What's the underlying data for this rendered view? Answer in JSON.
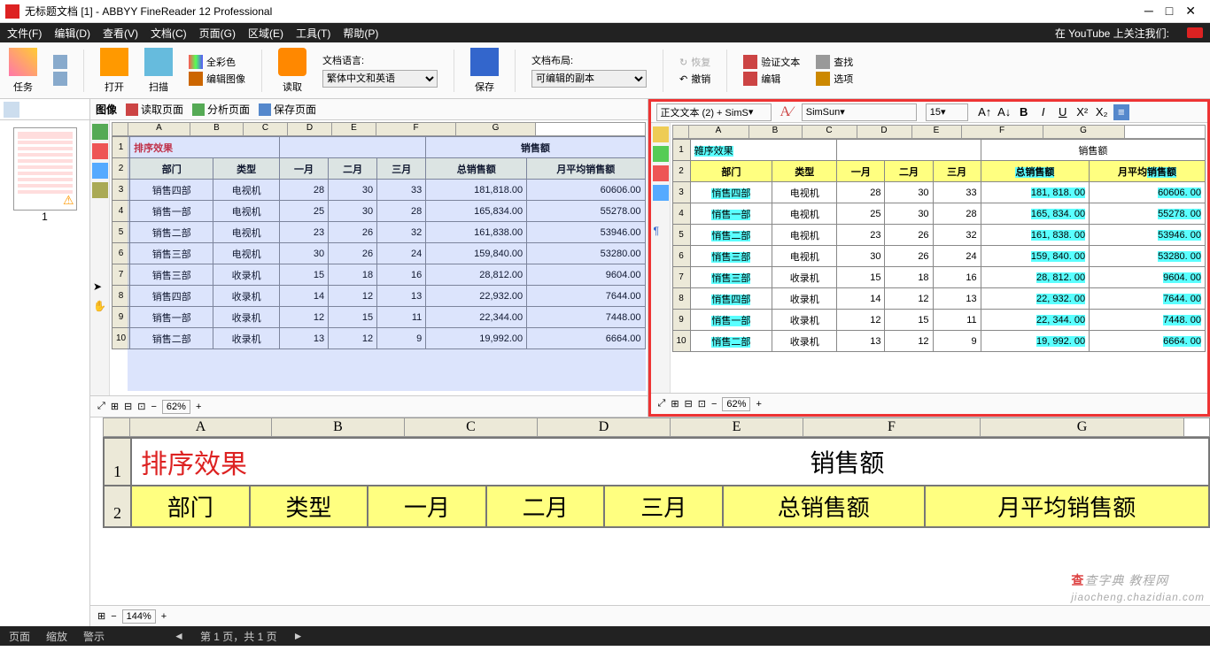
{
  "title": "无标题文档 [1] - ABBYY FineReader 12 Professional",
  "menu": [
    "文件(F)",
    "编辑(D)",
    "查看(V)",
    "文档(C)",
    "页面(G)",
    "区域(E)",
    "工具(T)",
    "帮助(P)"
  ],
  "yt": "在 YouTube 上关注我们:",
  "ribbon": {
    "task": "任务",
    "open": "打开",
    "scan": "扫描",
    "read": "读取",
    "save": "保存",
    "fullcolor": "全彩色",
    "editimg": "编辑图像",
    "doclang_lbl": "文档语言:",
    "doclang": "繁体中文和英语",
    "layout_lbl": "文档布局:",
    "layout": "可编辑的副本",
    "restore": "恢复",
    "undo": "撤销",
    "verify": "验证文本",
    "edit": "编辑",
    "find": "查找",
    "options": "选项"
  },
  "panetabs": {
    "image": "图像",
    "readpg": "读取页面",
    "analyze": "分析页面",
    "savepg": "保存页面",
    "bodytext": "正文文本 (2) + SimS",
    "font": "SimSun",
    "size": "15"
  },
  "page_label": "1",
  "cols": [
    "A",
    "B",
    "C",
    "D",
    "E",
    "F",
    "G"
  ],
  "sheet": {
    "title1": "排序效果",
    "title2": "销售额",
    "headers": [
      "部门",
      "类型",
      "一月",
      "二月",
      "三月",
      "总销售额",
      "月平均销售额"
    ],
    "rows": [
      {
        "n": "3",
        "d": "销售四部",
        "t": "电视机",
        "m1": "28",
        "m2": "30",
        "m3": "33",
        "tot": "181,818.00",
        "avg": "60606.00"
      },
      {
        "n": "4",
        "d": "销售一部",
        "t": "电视机",
        "m1": "25",
        "m2": "30",
        "m3": "28",
        "tot": "165,834.00",
        "avg": "55278.00"
      },
      {
        "n": "5",
        "d": "销售二部",
        "t": "电视机",
        "m1": "23",
        "m2": "26",
        "m3": "32",
        "tot": "161,838.00",
        "avg": "53946.00"
      },
      {
        "n": "6",
        "d": "销售三部",
        "t": "电视机",
        "m1": "30",
        "m2": "26",
        "m3": "24",
        "tot": "159,840.00",
        "avg": "53280.00"
      },
      {
        "n": "7",
        "d": "销售三部",
        "t": "收录机",
        "m1": "15",
        "m2": "18",
        "m3": "16",
        "tot": "28,812.00",
        "avg": "9604.00"
      },
      {
        "n": "8",
        "d": "销售四部",
        "t": "收录机",
        "m1": "14",
        "m2": "12",
        "m3": "13",
        "tot": "22,932.00",
        "avg": "7644.00"
      },
      {
        "n": "9",
        "d": "销售一部",
        "t": "收录机",
        "m1": "12",
        "m2": "15",
        "m3": "11",
        "tot": "22,344.00",
        "avg": "7448.00"
      },
      {
        "n": "10",
        "d": "销售二部",
        "t": "收录机",
        "m1": "13",
        "m2": "12",
        "m3": "9",
        "tot": "19,992.00",
        "avg": "6664.00"
      }
    ]
  },
  "right_sheet": {
    "title1": "雑序效果",
    "title2": "销售额",
    "rows": [
      {
        "n": "3",
        "d": "悄售四部",
        "t": "电视机",
        "m1": "28",
        "m2": "30",
        "m3": "33",
        "tot": "181, 818. 00",
        "avg": "60606. 00"
      },
      {
        "n": "4",
        "d": "悄售一部",
        "t": "电视机",
        "m1": "25",
        "m2": "30",
        "m3": "28",
        "tot": "165, 834. 00",
        "avg": "55278. 00"
      },
      {
        "n": "5",
        "d": "悄售二部",
        "t": "电视机",
        "m1": "23",
        "m2": "26",
        "m3": "32",
        "tot": "161, 838. 00",
        "avg": "53946. 00"
      },
      {
        "n": "6",
        "d": "悄售三部",
        "t": "电视机",
        "m1": "30",
        "m2": "26",
        "m3": "24",
        "tot": "159, 840. 00",
        "avg": "53280. 00"
      },
      {
        "n": "7",
        "d": "悄售三部",
        "t": "收录机",
        "m1": "15",
        "m2": "18",
        "m3": "16",
        "tot": "28, 812. 00",
        "avg": "9604. 00"
      },
      {
        "n": "8",
        "d": "悄售四部",
        "t": "收录机",
        "m1": "14",
        "m2": "12",
        "m3": "13",
        "tot": "22, 932. 00",
        "avg": "7644. 00"
      },
      {
        "n": "9",
        "d": "悄售一部",
        "t": "收录机",
        "m1": "12",
        "m2": "15",
        "m3": "11",
        "tot": "22, 344. 00",
        "avg": "7448. 00"
      },
      {
        "n": "10",
        "d": "悄售二部",
        "t": "收录机",
        "m1": "13",
        "m2": "12",
        "m3": "9",
        "tot": "19, 992. 00",
        "avg": "6664. 00"
      }
    ]
  },
  "zoom1": "62%",
  "zoom2": "62%",
  "zoom3": "144%",
  "bottom": {
    "page": "页面",
    "zoom": "缩放",
    "warn": "警示",
    "nav": "第 1 页，共 1 页"
  },
  "watermark": "查字典 教程网",
  "watermark_url": "jiaocheng.chazidian.com"
}
